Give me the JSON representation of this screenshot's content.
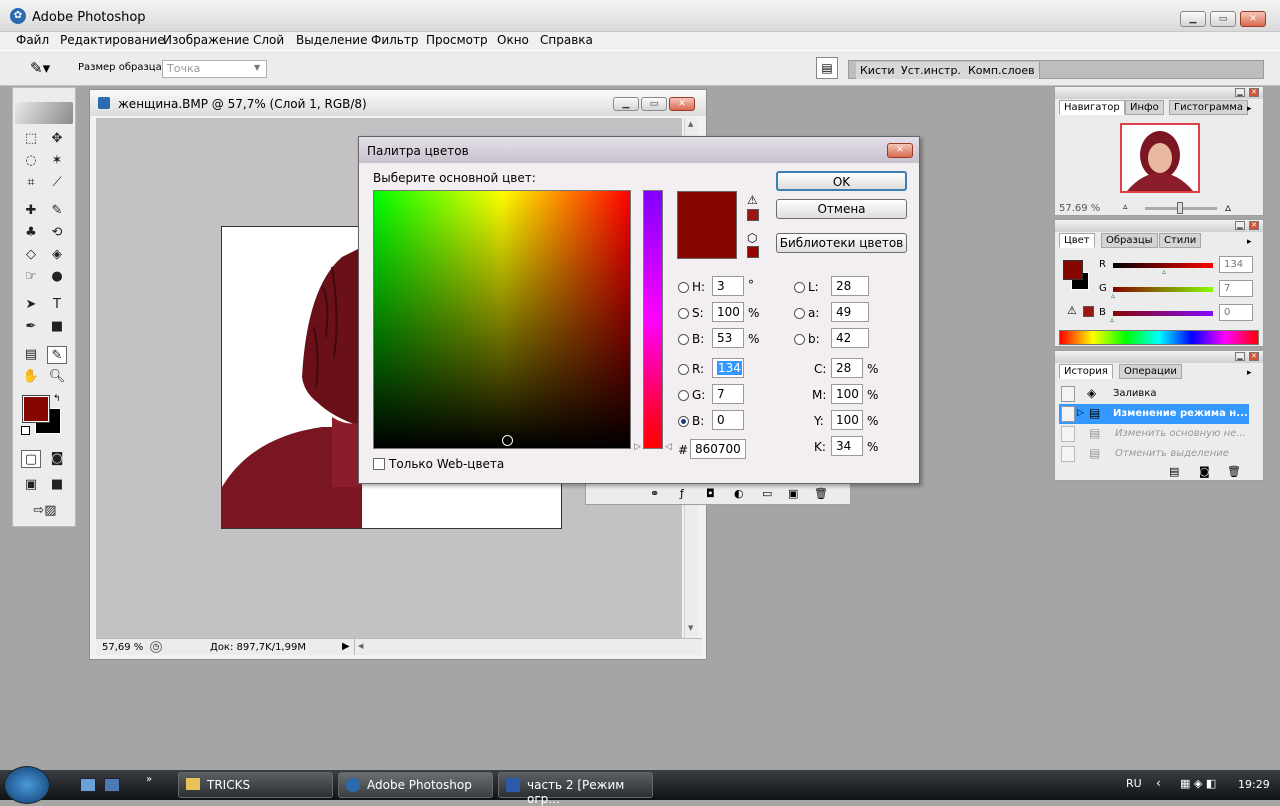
{
  "app": {
    "title": "Adobe Photoshop"
  },
  "menu": [
    "Файл",
    "Редактирование",
    "Изображение",
    "Слой",
    "Выделение",
    "Фильтр",
    "Просмотр",
    "Окно",
    "Справка"
  ],
  "options": {
    "sample_label": "Размер образца:",
    "sample_value": "Точка",
    "wells": [
      "Кисти",
      "Уст.инстр.",
      "Комп.слоев"
    ]
  },
  "document": {
    "title": "женщина.BMP @ 57,7% (Слой 1, RGB/8)",
    "zoom": "57,69 %",
    "doc_info": "Док: 897,7K/1,99M"
  },
  "dialog": {
    "title": "Палитра цветов",
    "prompt": "Выберите основной цвет:",
    "ok": "OK",
    "cancel": "Отмена",
    "libraries": "Библиотеки цветов",
    "web_only": "Только Web-цвета",
    "color_hex": "#860700",
    "fields": {
      "H": {
        "label": "H:",
        "value": "3",
        "unit": "°"
      },
      "S": {
        "label": "S:",
        "value": "100",
        "unit": "%"
      },
      "Bv": {
        "label": "B:",
        "value": "53",
        "unit": "%"
      },
      "R": {
        "label": "R:",
        "value": "134"
      },
      "G": {
        "label": "G:",
        "value": "7"
      },
      "Bl": {
        "label": "B:",
        "value": "0"
      },
      "L": {
        "label": "L:",
        "value": "28"
      },
      "a": {
        "label": "a:",
        "value": "49"
      },
      "b": {
        "label": "b:",
        "value": "42"
      },
      "C": {
        "label": "C:",
        "value": "28",
        "unit": "%"
      },
      "M": {
        "label": "M:",
        "value": "100",
        "unit": "%"
      },
      "Y": {
        "label": "Y:",
        "value": "100",
        "unit": "%"
      },
      "K": {
        "label": "K:",
        "value": "34",
        "unit": "%"
      },
      "hex_label": "#",
      "hex": "860700"
    }
  },
  "navigator": {
    "tabs": [
      "Навигатор",
      "Инфо",
      "Гистограмма"
    ],
    "zoom": "57.69 %"
  },
  "color_panel": {
    "tabs": [
      "Цвет",
      "Образцы",
      "Стили"
    ],
    "R": "134",
    "G": "7",
    "B": "0",
    "R_label": "R",
    "G_label": "G",
    "B_label": "B"
  },
  "history": {
    "tabs": [
      "История",
      "Операции"
    ],
    "items": [
      "Заливка",
      "Изменение режима н...",
      "Изменить основную не...",
      "Отменить выделение"
    ]
  },
  "taskbar": {
    "buttons": [
      "TRICKS",
      "Adobe Photoshop",
      "часть 2 [Режим огр..."
    ],
    "lang": "RU",
    "time": "19:29"
  },
  "colors": {
    "foreground": "#860700",
    "accent": "#3399ff"
  }
}
